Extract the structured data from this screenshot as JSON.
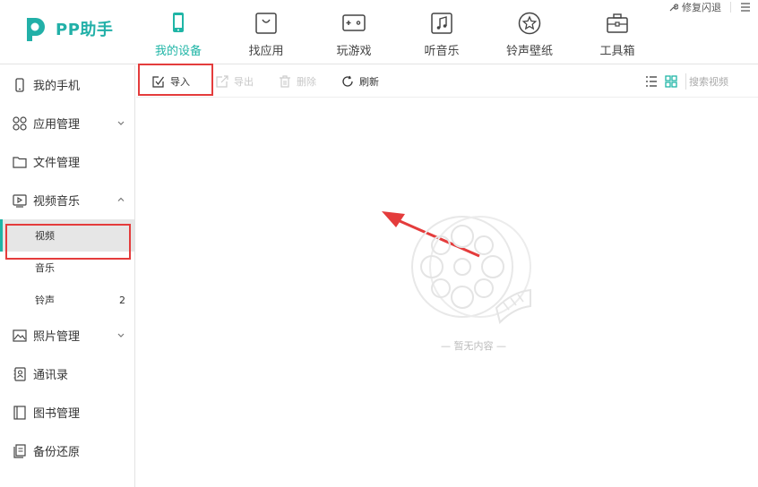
{
  "app": {
    "brand": "PP助手",
    "accent_color": "#1fb5a6",
    "highlight_color": "#e43c3c"
  },
  "header": {
    "nav": [
      {
        "label": "我的设备",
        "icon": "phone-icon",
        "active": true
      },
      {
        "label": "找应用",
        "icon": "app-bag-icon",
        "active": false
      },
      {
        "label": "玩游戏",
        "icon": "gamepad-icon",
        "active": false
      },
      {
        "label": "听音乐",
        "icon": "music-icon",
        "active": false
      },
      {
        "label": "铃声壁纸",
        "icon": "star-icon",
        "active": false
      },
      {
        "label": "工具箱",
        "icon": "toolbox-icon",
        "active": false
      }
    ],
    "fix_label": "修复闪退"
  },
  "sidebar": {
    "items": [
      {
        "label": "我的手机",
        "icon": "phone-outline-icon"
      },
      {
        "label": "应用管理",
        "icon": "apps-grid-icon",
        "expandable": true,
        "expanded": false
      },
      {
        "label": "文件管理",
        "icon": "folder-icon"
      },
      {
        "label": "视频音乐",
        "icon": "video-icon",
        "expandable": true,
        "expanded": true
      }
    ],
    "subitems": [
      {
        "label": "视频",
        "active": true,
        "count": ""
      },
      {
        "label": "音乐",
        "active": false,
        "count": ""
      },
      {
        "label": "铃声",
        "active": false,
        "count": "2"
      }
    ],
    "items_after": [
      {
        "label": "照片管理",
        "icon": "photo-icon",
        "expandable": true,
        "expanded": false
      },
      {
        "label": "通讯录",
        "icon": "contacts-icon"
      },
      {
        "label": "图书管理",
        "icon": "book-icon"
      },
      {
        "label": "备份还原",
        "icon": "backup-icon"
      }
    ]
  },
  "toolbar": {
    "import_label": "导入",
    "export_label": "导出",
    "delete_label": "删除",
    "refresh_label": "刷新",
    "search_placeholder": "搜索视频"
  },
  "content": {
    "empty_text": "— 暂无内容 —"
  }
}
